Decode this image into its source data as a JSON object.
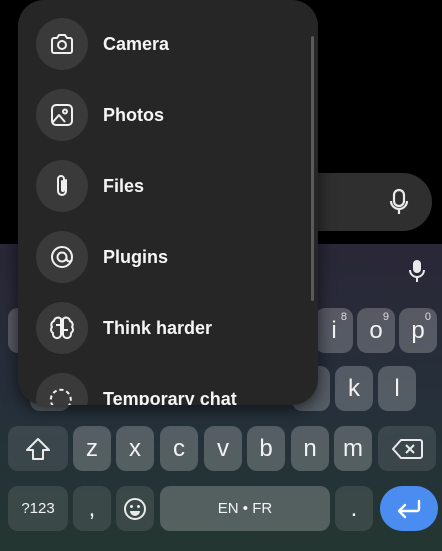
{
  "menu": {
    "items": [
      {
        "label": "Camera",
        "icon": "camera-icon"
      },
      {
        "label": "Photos",
        "icon": "photos-icon"
      },
      {
        "label": "Files",
        "icon": "paperclip-icon"
      },
      {
        "label": "Plugins",
        "icon": "plugins-icon"
      },
      {
        "label": "Think harder",
        "icon": "brain-icon"
      },
      {
        "label": "Temporary chat",
        "icon": "temporary-chat-icon"
      }
    ]
  },
  "keyboard": {
    "row1": {
      "i": "i",
      "i_hint": "8",
      "o": "o",
      "o_hint": "9",
      "p": "p",
      "p_hint": "0"
    },
    "row2": {
      "k": "k",
      "l": "l"
    },
    "row3": [
      "z",
      "x",
      "c",
      "v",
      "b",
      "n",
      "m"
    ],
    "bottom": {
      "symbols": "?123",
      "comma": ",",
      "space": "EN • FR",
      "period": "."
    }
  },
  "colors": {
    "enter_key": "#4a8cf0",
    "menu_background": "#262626",
    "icon_circle": "#3a3a3a"
  }
}
